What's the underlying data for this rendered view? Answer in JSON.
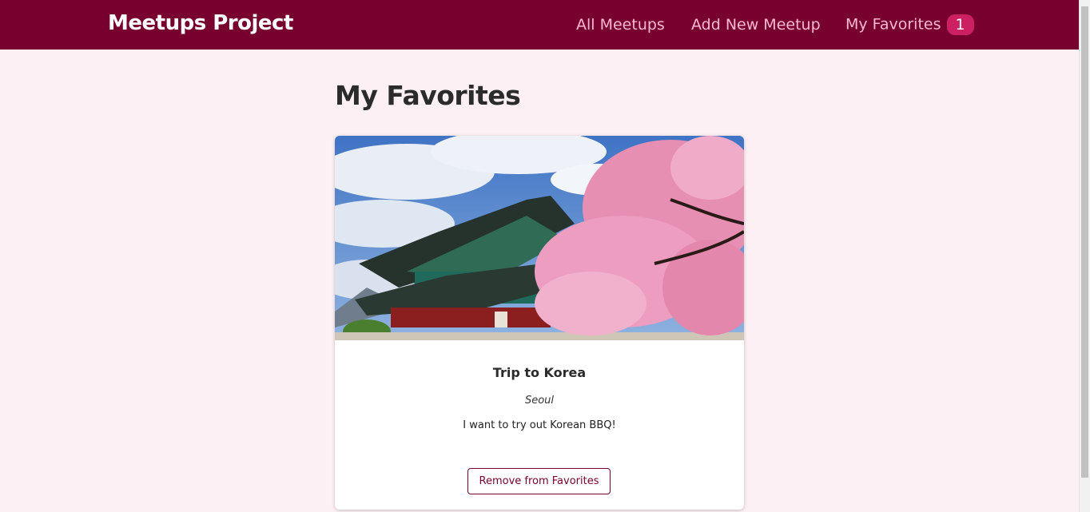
{
  "header": {
    "logo": "Meetups Project",
    "nav": {
      "all_meetups": "All Meetups",
      "add_new_meetup": "Add New Meetup",
      "my_favorites": "My Favorites",
      "favorites_count": "1"
    }
  },
  "main": {
    "title": "My Favorites",
    "meetups": [
      {
        "title": "Trip to Korea",
        "address": "Seoul",
        "description": "I want to try out Korean BBQ!",
        "image_alt": "Korean palace with cherry blossoms",
        "button": "Remove from Favorites"
      }
    ]
  },
  "colors": {
    "header_bg": "#77002e",
    "nav_link": "#fcb8d2",
    "badge_bg": "#cc2062",
    "page_bg": "#fdf0f4"
  }
}
